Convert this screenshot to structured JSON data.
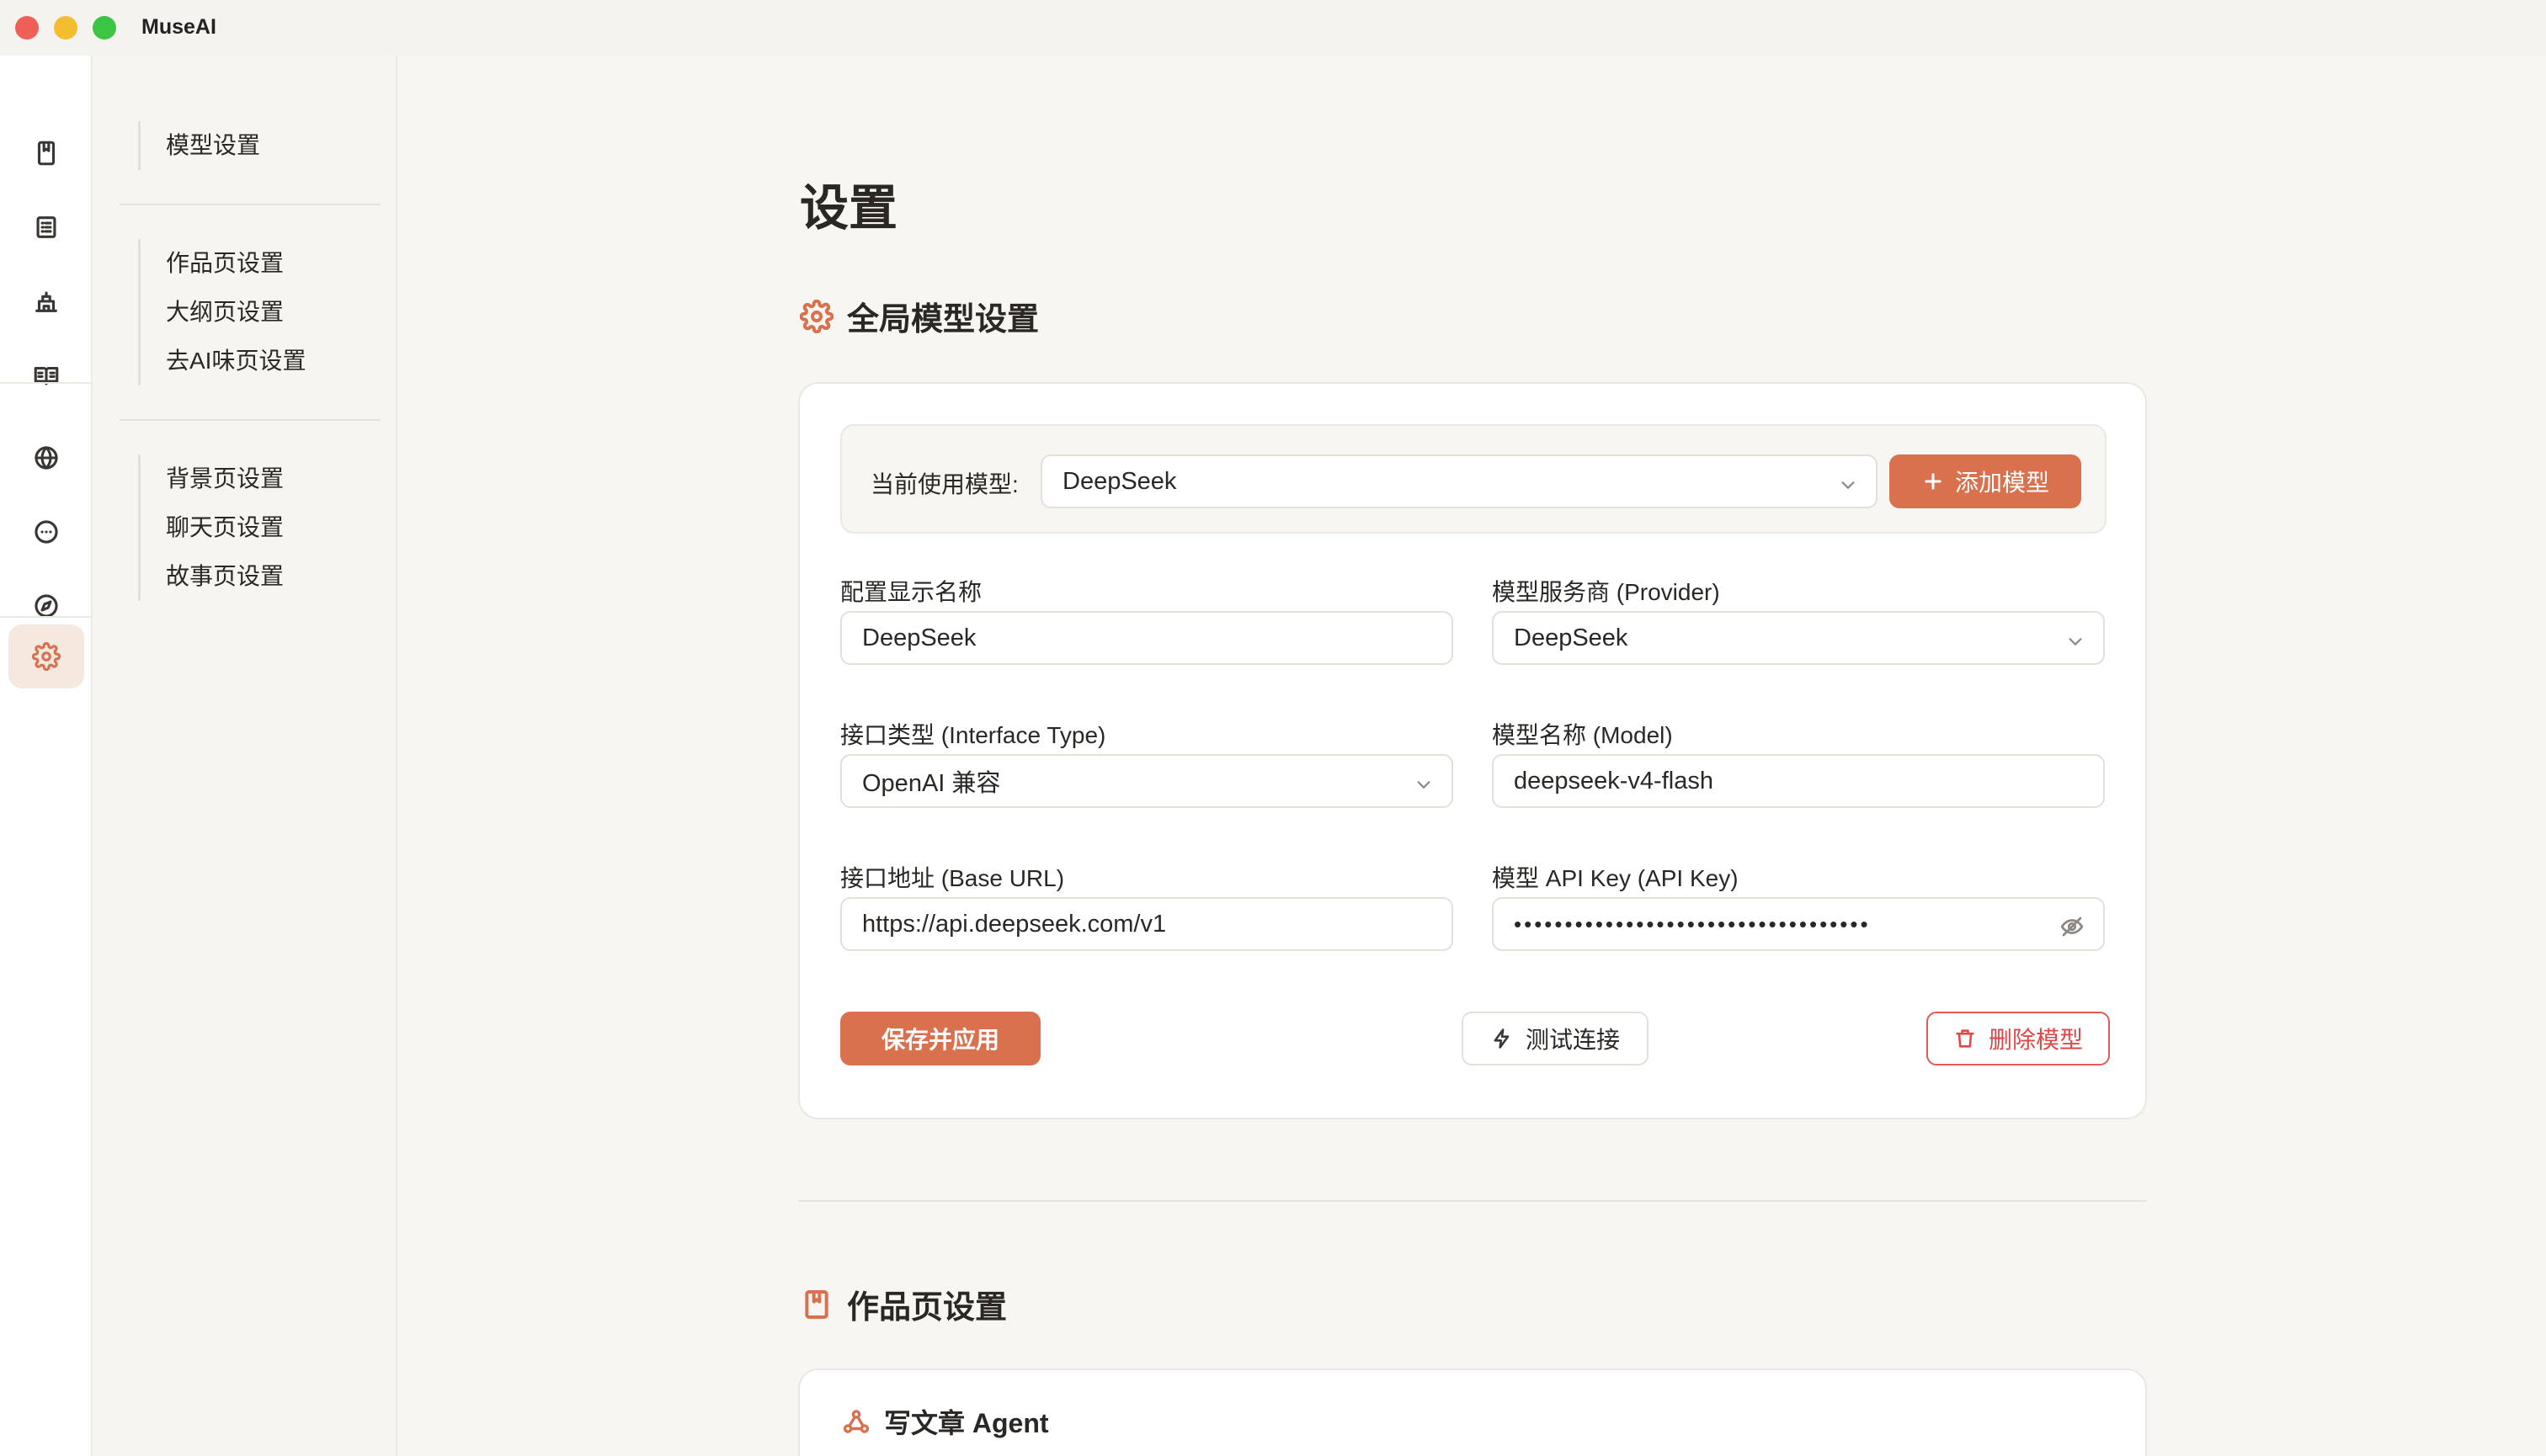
{
  "app": {
    "title": "MuseAI"
  },
  "rail": {
    "items": [
      {
        "name": "works-icon"
      },
      {
        "name": "outline-icon"
      },
      {
        "name": "building-icon"
      },
      {
        "name": "book-icon"
      },
      {
        "name": "globe-icon"
      },
      {
        "name": "chat-icon"
      },
      {
        "name": "compass-icon"
      },
      {
        "name": "settings-icon",
        "active": true
      }
    ]
  },
  "subnav": {
    "group1": [
      "模型设置"
    ],
    "group2": [
      "作品页设置",
      "大纲页设置",
      "去AI味页设置"
    ],
    "group3": [
      "背景页设置",
      "聊天页设置",
      "故事页设置"
    ]
  },
  "page": {
    "title": "设置",
    "global_section_title": "全局模型设置",
    "works_section_title": "作品页设置"
  },
  "model_card": {
    "current_label": "当前使用模型:",
    "current_value": "DeepSeek",
    "add_button": "添加模型",
    "fields": {
      "display_name_label": "配置显示名称",
      "display_name_value": "DeepSeek",
      "provider_label": "模型服务商 (Provider)",
      "provider_value": "DeepSeek",
      "interface_label": "接口类型 (Interface Type)",
      "interface_value": "OpenAI 兼容",
      "model_label": "模型名称 (Model)",
      "model_value": "deepseek-v4-flash",
      "base_url_label": "接口地址 (Base URL)",
      "base_url_value": "https://api.deepseek.com/v1",
      "api_key_label": "模型 API Key (API Key)",
      "api_key_value": "•••••••••••••••••••••••••••••••••••"
    },
    "save_button": "保存并应用",
    "test_button": "测试连接",
    "delete_button": "删除模型"
  },
  "works_card": {
    "agent_title": "写文章 Agent"
  },
  "colors": {
    "accent": "#d9714f",
    "danger": "#e04848",
    "background": "#f8f6f2"
  }
}
